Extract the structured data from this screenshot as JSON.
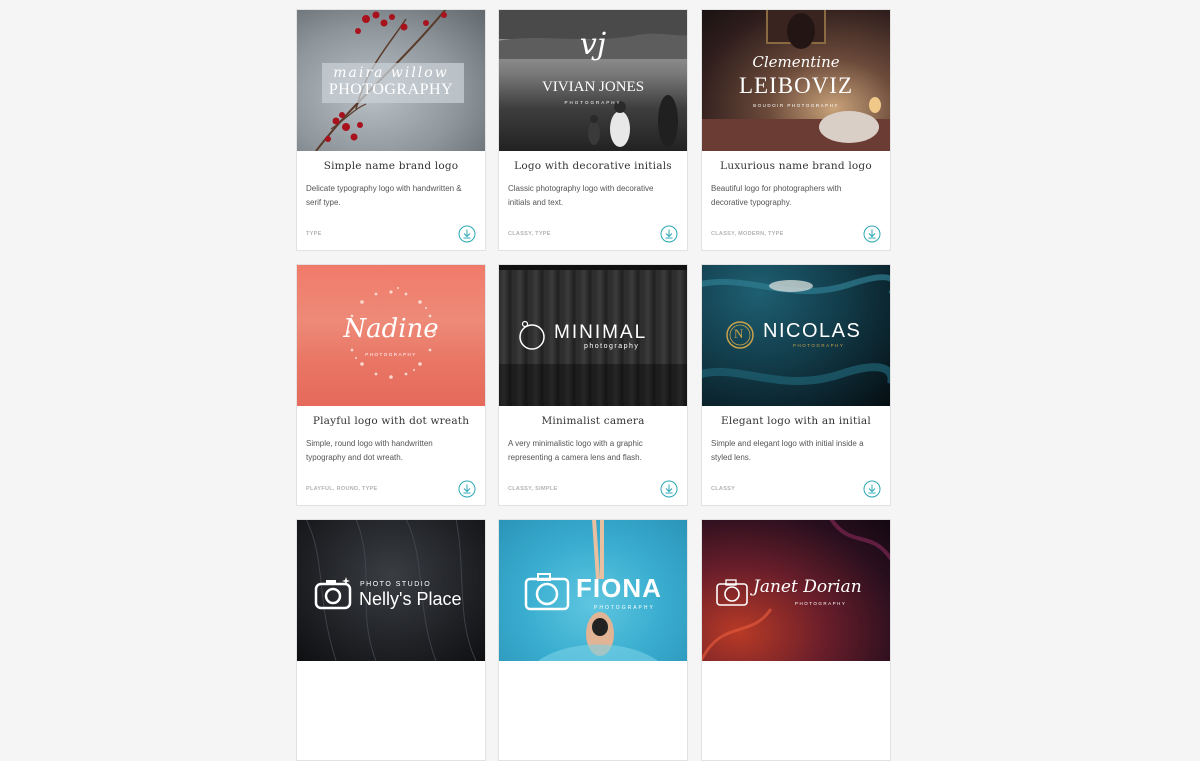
{
  "cards": [
    {
      "title": "Simple name brand logo",
      "description": "Delicate typography logo with handwritten & serif type.",
      "tags": "TYPE",
      "logo": {
        "script": "maira willow",
        "main": "PHOTOGRAPHY"
      }
    },
    {
      "title": "Logo with decorative initials",
      "description": "Classic photography logo with decorative initials and text.",
      "tags": "CLASSY, TYPE",
      "logo": {
        "initials": "vj",
        "main": "VIVIAN JONES",
        "sub": "PHOTOGRAPHY"
      }
    },
    {
      "title": "Luxurious name brand logo",
      "description": "Beautiful logo for photographers with decorative typography.",
      "tags": "CLASSY, MODERN, TYPE",
      "logo": {
        "script": "Clementine",
        "main": "LEIBOVIZ",
        "sub": "BOUDOIR PHOTOGRAPHY"
      }
    },
    {
      "title": "Playful logo with dot wreath",
      "description": "Simple, round logo with handwritten typography and dot wreath.",
      "tags": "PLAYFUL, ROUND, TYPE",
      "logo": {
        "script": "Nadine",
        "sub": "PHOTOGRAPHY"
      }
    },
    {
      "title": "Minimalist camera",
      "description": "A very minimalistic logo with a graphic representing a camera lens and flash.",
      "tags": "CLASSY, SIMPLE",
      "logo": {
        "main": "MINIMAL",
        "sub": "photography"
      }
    },
    {
      "title": "Elegant logo with an initial",
      "description": "Simple and elegant logo with initial inside a styled lens.",
      "tags": "CLASSY",
      "logo": {
        "initial": "N",
        "main": "NICOLAS",
        "sub": "PHOTOGRAPHY"
      }
    },
    {
      "logo": {
        "top": "PHOTO STUDIO",
        "main": "Nelly's Place"
      }
    },
    {
      "logo": {
        "main": "FIONA",
        "sub": "PHOTOGRAPHY"
      }
    },
    {
      "logo": {
        "script": "Janet Dorian",
        "sub": "PHOTOGRAPHY"
      }
    }
  ],
  "colors": {
    "accent": "#2aa8b4",
    "page_bg": "#f5f5f5",
    "card_border": "#e2e2e2",
    "tag_text": "#b3b3b3"
  },
  "icons": {
    "download": "download-circle-icon"
  }
}
